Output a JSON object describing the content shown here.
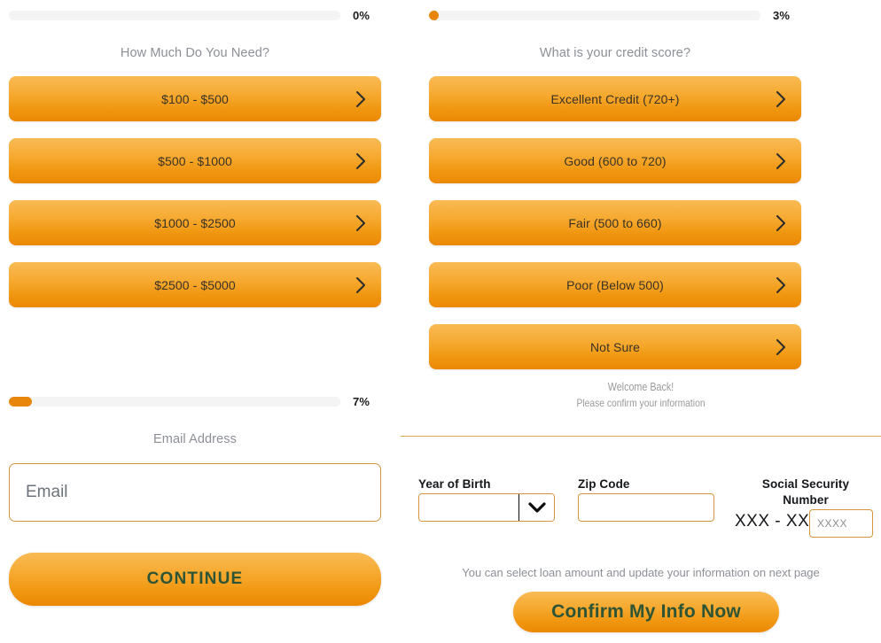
{
  "left_column": {
    "progress": {
      "percent_label": "0%",
      "percent_value": 0
    },
    "question": "How Much Do You Need?",
    "options": [
      {
        "label": "$100 - $500"
      },
      {
        "label": "$500 - $1000"
      },
      {
        "label": "$1000 - $2500"
      },
      {
        "label": "$2500 - $5000"
      }
    ],
    "email_section": {
      "progress": {
        "percent_label": "7%",
        "percent_value": 7
      },
      "label": "Email Address",
      "placeholder": "Email",
      "value": "",
      "continue_label": "CONTINUE"
    }
  },
  "right_column": {
    "progress": {
      "percent_label": "3%",
      "percent_value": 3
    },
    "question": "What is your credit score?",
    "options": [
      {
        "label": "Excellent Credit (720+)"
      },
      {
        "label": "Good (600 to 720)"
      },
      {
        "label": "Fair (500 to 660)"
      },
      {
        "label": "Poor (Below 500)"
      },
      {
        "label": "Not Sure"
      }
    ],
    "welcome": {
      "line1": "Welcome Back!",
      "line2": "Please confirm your information"
    },
    "form": {
      "year_of_birth": {
        "label": "Year of Birth",
        "value": "",
        "selected": ""
      },
      "zip_code": {
        "label": "Zip Code",
        "value": "",
        "placeholder": ""
      },
      "ssn": {
        "label_line1": "Social Security",
        "label_line2": "Number",
        "masked_prefix": "XXX - XX -",
        "placeholder": "XXXX",
        "value": ""
      }
    },
    "footer_note": "You can select loan amount and update your information on next page",
    "confirm_label": "Confirm My Info Now"
  },
  "icons": {
    "chevron_right": "chevron-right-icon",
    "chevron_down": "chevron-down-icon"
  },
  "colors": {
    "accent_orange": "#ee8c07",
    "accent_orange_light": "#f9bb55",
    "cta_text_green": "#2d5434",
    "border_gold": "#d5953c",
    "muted_text": "#8c9096",
    "track_gray": "#f4f4f4"
  }
}
